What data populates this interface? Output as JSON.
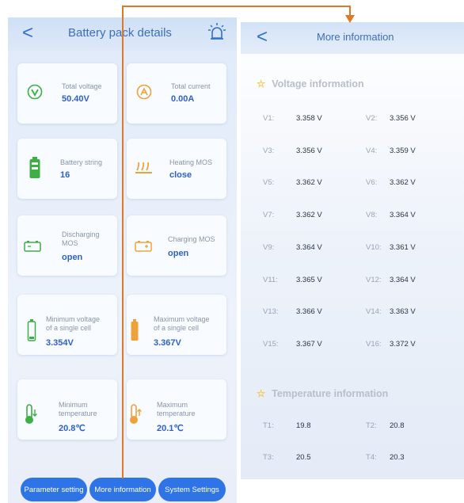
{
  "left": {
    "title": "Battery pack details",
    "back": "<",
    "cards": {
      "total_voltage": {
        "label": "Total voltage",
        "value": "50.40V"
      },
      "total_current": {
        "label": "Total current",
        "value": "0.00A"
      },
      "battery_string": {
        "label": "Battery string",
        "value": "16"
      },
      "heating_mos": {
        "label": "Heating MOS",
        "value": "close"
      },
      "discharging_mos": {
        "label1": "Discharging",
        "label2": "MOS",
        "value": "open"
      },
      "charging_mos": {
        "label": "Charging MOS",
        "value": "open"
      },
      "min_voltage": {
        "label1": "Minimum voltage",
        "label2": "of a single cell",
        "value": "3.354V"
      },
      "max_voltage": {
        "label1": "Maximum voltage",
        "label2": "of a single cell",
        "value": "3.367V"
      },
      "min_temp": {
        "label1": "Minimum",
        "label2": "temperature",
        "value": "20.8℃"
      },
      "max_temp": {
        "label1": "Maximum",
        "label2": "temperature",
        "value": "20.1℃"
      }
    },
    "buttons": {
      "parameter_setting": "Parameter setting",
      "more_information": "More information",
      "system_settings": "System Settings"
    }
  },
  "right": {
    "title": "More information",
    "back": "<",
    "voltage_section": "Voltage information",
    "temperature_section": "Temperature information",
    "voltages": [
      {
        "l": "V1:",
        "v": "3.358 V"
      },
      {
        "l": "V2:",
        "v": "3.356 V"
      },
      {
        "l": "V3:",
        "v": "3.356 V"
      },
      {
        "l": "V4:",
        "v": "3.359 V"
      },
      {
        "l": "V5:",
        "v": "3.362 V"
      },
      {
        "l": "V6:",
        "v": "3.362 V"
      },
      {
        "l": "V7:",
        "v": "3.362 V"
      },
      {
        "l": "V8:",
        "v": "3.364 V"
      },
      {
        "l": "V9:",
        "v": "3.364 V"
      },
      {
        "l": "V10:",
        "v": "3.361 V"
      },
      {
        "l": "V11:",
        "v": "3.365 V"
      },
      {
        "l": "V12:",
        "v": "3.364 V"
      },
      {
        "l": "V13:",
        "v": "3.366 V"
      },
      {
        "l": "V14:",
        "v": "3.363 V"
      },
      {
        "l": "V15:",
        "v": "3.367 V"
      },
      {
        "l": "V16:",
        "v": "3.372 V"
      }
    ],
    "temperatures": [
      {
        "l": "T1:",
        "v": "19.8"
      },
      {
        "l": "T2:",
        "v": "20.8"
      },
      {
        "l": "T3:",
        "v": "20.5"
      },
      {
        "l": "T4:",
        "v": "20.3"
      }
    ]
  },
  "colors": {
    "accent": "#2f74e6",
    "arrow": "#e0782a",
    "value_blue": "#2f62c0"
  }
}
